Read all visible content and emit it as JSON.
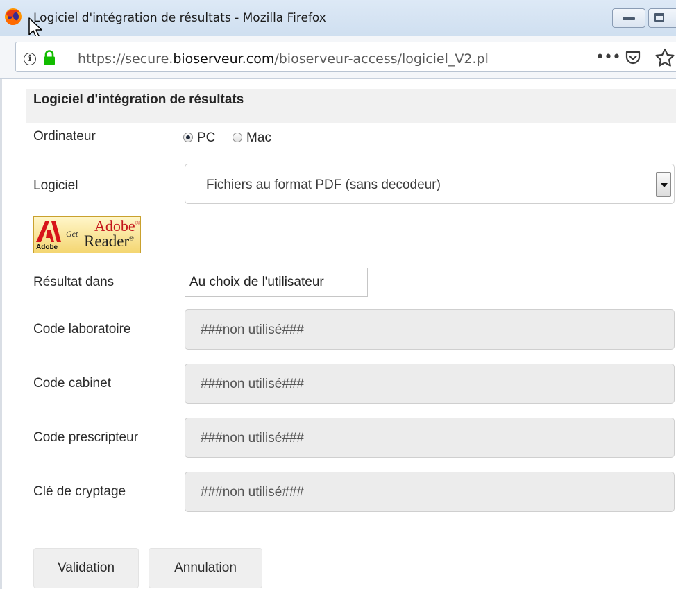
{
  "window": {
    "title": "Logiciel d'intégration de résultats - Mozilla Firefox"
  },
  "urlbar": {
    "url_prefix": "https://secure.",
    "url_domain": "bioserveur.com",
    "url_path": "/bioserveur-access/logiciel_V2.pl",
    "more_label": "•••"
  },
  "form": {
    "header": "Logiciel d'intégration de résultats",
    "ordinateur": {
      "label": "Ordinateur",
      "options": [
        "PC",
        "Mac"
      ],
      "selected": "PC"
    },
    "logiciel": {
      "label": "Logiciel",
      "selected": "Fichiers au format PDF (sans decodeur)"
    },
    "adobe_badge": {
      "brand": "Adobe",
      "get": "Get",
      "product_top": "Adobe",
      "product_bottom": "Reader"
    },
    "resultat": {
      "label": "Résultat dans",
      "value": "Au choix de l'utilisateur"
    },
    "code_laboratoire": {
      "label": "Code laboratoire",
      "value": "###non utilisé###"
    },
    "code_cabinet": {
      "label": "Code cabinet",
      "value": "###non utilisé###"
    },
    "code_prescripteur": {
      "label": "Code prescripteur",
      "value": "###non utilisé###"
    },
    "cle_cryptage": {
      "label": "Clé de cryptage",
      "value": "###non utilisé###"
    },
    "buttons": {
      "validation": "Validation",
      "annulation": "Annulation"
    }
  },
  "colors": {
    "titlebar": "#d6e4f3",
    "lock": "#12bc00",
    "adobe_red": "#c4161c",
    "disabled_field": "#ececec"
  }
}
